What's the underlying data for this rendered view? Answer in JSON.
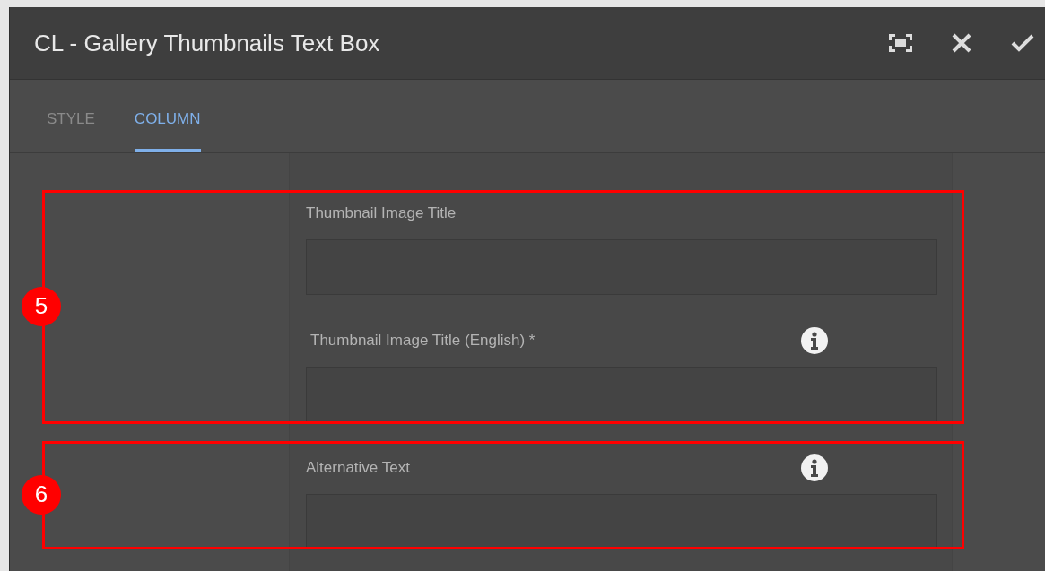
{
  "dialog": {
    "title": "CL - Gallery Thumbnails Text Box"
  },
  "tabs": [
    {
      "label": "STYLE",
      "selected": false
    },
    {
      "label": "COLUMN",
      "selected": true
    }
  ],
  "fields": [
    {
      "label": "Thumbnail Image Title",
      "info": false
    },
    {
      "label": "Thumbnail Image Title (English) *",
      "info": true
    },
    {
      "label": "Alternative Text",
      "info": true
    }
  ],
  "callouts": [
    {
      "number": "5"
    },
    {
      "number": "6"
    }
  ]
}
